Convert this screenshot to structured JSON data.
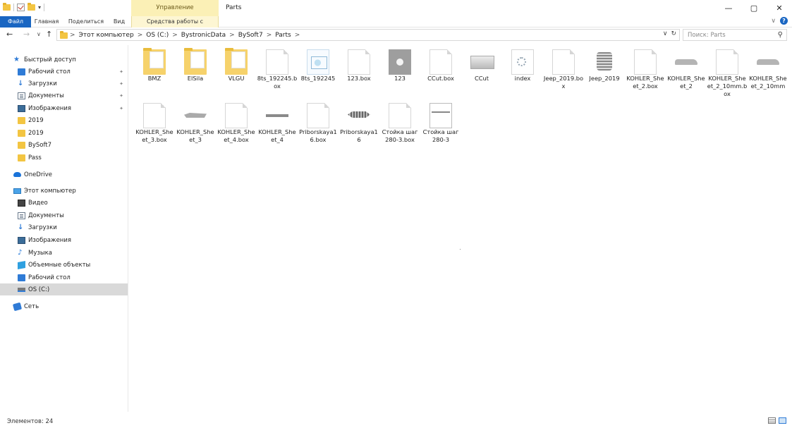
{
  "window": {
    "title": "Parts",
    "manage_label": "Управление",
    "controls": {
      "minimize": "—",
      "maximize": "▢",
      "close": "✕"
    }
  },
  "ribbon": {
    "tabs": [
      "Файл",
      "Главная",
      "Поделиться",
      "Вид",
      "Средства работы с рисунками"
    ],
    "collapse": "∨",
    "help": "?"
  },
  "address": {
    "crumbs": [
      "Этот компьютер",
      "OS (C:)",
      "BystronicData",
      "BySoft7",
      "Parts"
    ],
    "separator": ">",
    "dropdown": "∨",
    "refresh": "↻"
  },
  "search": {
    "placeholder": "Поиск: Parts"
  },
  "sidebar": {
    "quick_access": "Быстрый доступ",
    "quick_items": [
      "Рабочий стол",
      "Загрузки",
      "Документы",
      "Изображения",
      "2019",
      "2019",
      "BySoft7",
      "Pass"
    ],
    "onedrive": "OneDrive",
    "this_pc": "Этот компьютер",
    "pc_items": [
      "Видео",
      "Документы",
      "Загрузки",
      "Изображения",
      "Музыка",
      "Объемные объекты",
      "Рабочий стол",
      "OS (C:)"
    ],
    "network": "Сеть"
  },
  "files": [
    {
      "name": "BMZ",
      "type": "folder"
    },
    {
      "name": "ElSila",
      "type": "folder"
    },
    {
      "name": "VLGU",
      "type": "folder"
    },
    {
      "name": "8ts_192245.box",
      "type": "file"
    },
    {
      "name": "8ts_192245",
      "type": "image"
    },
    {
      "name": "123.box",
      "type": "file"
    },
    {
      "name": "123",
      "type": "gray"
    },
    {
      "name": "CCut.box",
      "type": "file"
    },
    {
      "name": "CCut",
      "type": "ccut"
    },
    {
      "name": "index",
      "type": "gear"
    },
    {
      "name": "Jeep_2019.box",
      "type": "file"
    },
    {
      "name": "Jeep_2019",
      "type": "jeep"
    },
    {
      "name": "KOHLER_Sheet_2.box",
      "type": "file"
    },
    {
      "name": "KOHLER_Sheet_2",
      "type": "car"
    },
    {
      "name": "KOHLER_Sheet_2_10mm.box",
      "type": "file"
    },
    {
      "name": "KOHLER_Sheet_2_10mm",
      "type": "car"
    },
    {
      "name": "KOHLER_Sheet_3.box",
      "type": "file"
    },
    {
      "name": "KOHLER_Sheet_3",
      "type": "boat"
    },
    {
      "name": "KOHLER_Sheet_4.box",
      "type": "file"
    },
    {
      "name": "KOHLER_Sheet_4",
      "type": "long"
    },
    {
      "name": "Priborskaya16.box",
      "type": "file"
    },
    {
      "name": "Priborskaya16",
      "type": "fish"
    },
    {
      "name": "Стойка шаг 280-3.box",
      "type": "file"
    },
    {
      "name": "Стойка шаг 280-3",
      "type": "frame"
    }
  ],
  "status": {
    "count_text": "Элементов: 24"
  }
}
